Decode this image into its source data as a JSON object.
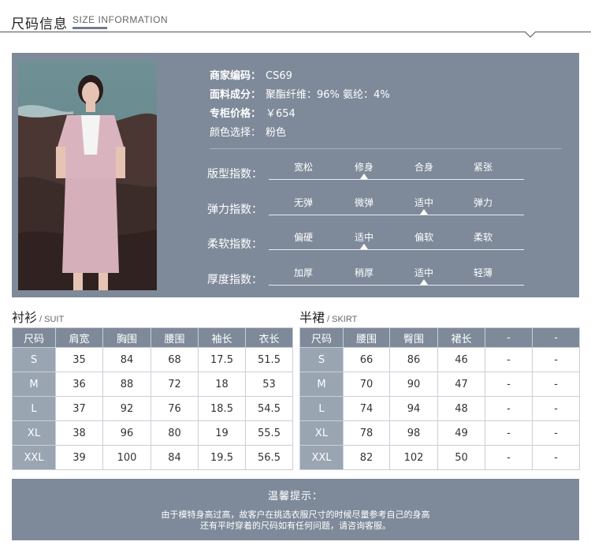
{
  "header": {
    "title": "尺码信息",
    "subtitle": "SIZE INFORMATION"
  },
  "product": {
    "fields": [
      {
        "key": "商家编码：",
        "value": "CS69"
      },
      {
        "key": "面料成分：",
        "value": "聚酯纤维：96%  氨纶：4%"
      },
      {
        "key": "专柜价格：",
        "value": "￥654"
      },
      {
        "key": "颜色选择：",
        "value": "粉色"
      }
    ]
  },
  "indices": [
    {
      "label": "版型指数：",
      "options": [
        "宽松",
        "修身",
        "合身",
        "紧张"
      ],
      "selected": 1
    },
    {
      "label": "弹力指数：",
      "options": [
        "无弹",
        "微弹",
        "适中",
        "弹力"
      ],
      "selected": 2
    },
    {
      "label": "柔软指数：",
      "options": [
        "偏硬",
        "适中",
        "偏软",
        "柔软"
      ],
      "selected": 1
    },
    {
      "label": "厚度指数：",
      "options": [
        "加厚",
        "稍厚",
        "适中",
        "轻薄"
      ],
      "selected": 2
    }
  ],
  "suit": {
    "title": "衬衫",
    "title_en": "/ SUIT",
    "headers": [
      "尺码",
      "肩宽",
      "胸围",
      "腰围",
      "袖长",
      "衣长"
    ],
    "rows": [
      [
        "S",
        "35",
        "84",
        "68",
        "17.5",
        "51.5"
      ],
      [
        "M",
        "36",
        "88",
        "72",
        "18",
        "53"
      ],
      [
        "L",
        "37",
        "92",
        "76",
        "18.5",
        "54.5"
      ],
      [
        "XL",
        "38",
        "96",
        "80",
        "19",
        "55.5"
      ],
      [
        "XXL",
        "39",
        "100",
        "84",
        "19.5",
        "56.5"
      ]
    ]
  },
  "skirt": {
    "title": "半裙",
    "title_en": "/ SKIRT",
    "headers": [
      "尺码",
      "腰围",
      "臀围",
      "裙长",
      "-",
      "-"
    ],
    "rows": [
      [
        "S",
        "66",
        "86",
        "46",
        "-",
        "-"
      ],
      [
        "M",
        "70",
        "90",
        "47",
        "-",
        "-"
      ],
      [
        "L",
        "74",
        "94",
        "48",
        "-",
        "-"
      ],
      [
        "XL",
        "78",
        "98",
        "49",
        "-",
        "-"
      ],
      [
        "XXL",
        "82",
        "102",
        "50",
        "-",
        "-"
      ]
    ]
  },
  "notice": {
    "title": "温馨提示：",
    "line1": "由于模特身高过高，故客户在挑选衣服尺寸的时候尽量参考自己的身高",
    "line2": "还有平时穿着的尺码如有任何问题，请咨询客服。"
  },
  "colors": {
    "panel": "#7e8a9a",
    "size_cell": "#9aa5b2",
    "suit_pink": "#d9b4be",
    "top_white": "#f4f4f4"
  }
}
